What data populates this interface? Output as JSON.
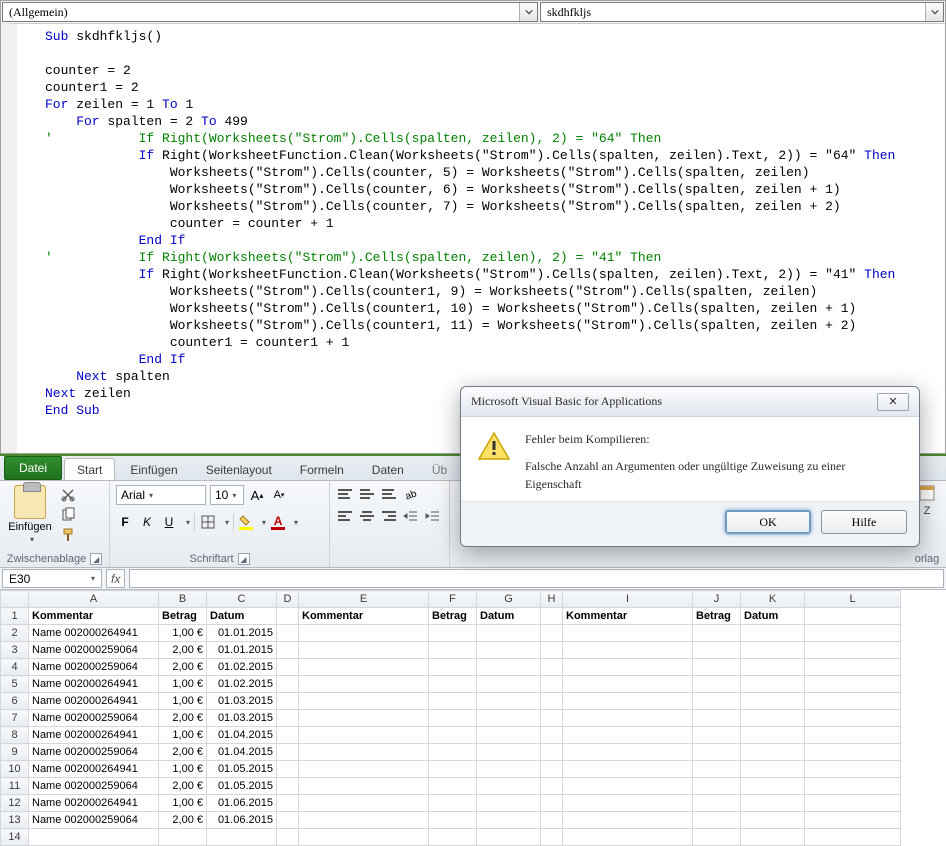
{
  "vba": {
    "object_dd": "(Allgemein)",
    "proc_dd": "skdhfkljs",
    "code": {
      "l1a": "Sub ",
      "l1b": "skdhfkljs()",
      "l2": "",
      "l3": "counter = 2",
      "l4": "counter1 = 2",
      "l5a": "For ",
      "l5b": "zeilen = 1 ",
      "l5c": "To ",
      "l5d": "1",
      "l6a": "    For ",
      "l6b": "spalten = 2 ",
      "l6c": "To ",
      "l6d": "499",
      "l7": "'           If Right(Worksheets(\"Strom\").Cells(spalten, zeilen), 2) = \"64\" Then",
      "l8a": "            If ",
      "l8b": "Right(WorksheetFunction.Clean(Worksheets(\"Strom\").Cells(spalten, zeilen).Text, 2)) = \"64\" ",
      "l8c": "Then",
      "l9": "                Worksheets(\"Strom\").Cells(counter, 5) = Worksheets(\"Strom\").Cells(spalten, zeilen)",
      "l10": "                Worksheets(\"Strom\").Cells(counter, 6) = Worksheets(\"Strom\").Cells(spalten, zeilen + 1)",
      "l11": "                Worksheets(\"Strom\").Cells(counter, 7) = Worksheets(\"Strom\").Cells(spalten, zeilen + 2)",
      "l12": "                counter = counter + 1",
      "l13a": "            End If",
      "l14": "'           If Right(Worksheets(\"Strom\").Cells(spalten, zeilen), 2) = \"41\" Then",
      "l15a": "            If ",
      "l15b": "Right(WorksheetFunction.Clean(Worksheets(\"Strom\").Cells(spalten, zeilen).Text, 2)) = \"41\" ",
      "l15c": "Then",
      "l16": "                Worksheets(\"Strom\").Cells(counter1, 9) = Worksheets(\"Strom\").Cells(spalten, zeilen)",
      "l17": "                Worksheets(\"Strom\").Cells(counter1, 10) = Worksheets(\"Strom\").Cells(spalten, zeilen + 1)",
      "l18": "                Worksheets(\"Strom\").Cells(counter1, 11) = Worksheets(\"Strom\").Cells(spalten, zeilen + 2)",
      "l19": "                counter1 = counter1 + 1",
      "l20a": "            End If",
      "l21a": "    Next ",
      "l21b": "spalten",
      "l22a": "Next ",
      "l22b": "zeilen",
      "l23": "End Sub"
    }
  },
  "dialog": {
    "title": "Microsoft Visual Basic for Applications",
    "close": "✕",
    "heading": "Fehler beim Kompilieren:",
    "message": "Falsche Anzahl an Argumenten oder ungültige Zuweisung zu einer Eigenschaft",
    "ok": "OK",
    "help": "Hilfe"
  },
  "excel": {
    "tabs": {
      "file": "Datei",
      "start": "Start",
      "insert": "Einfügen",
      "layout": "Seitenlayout",
      "formulas": "Formeln",
      "data": "Daten",
      "review_cut": "Üb"
    },
    "ribbon": {
      "clipboard": {
        "paste": "Einfügen",
        "title": "Zwischenablage"
      },
      "font": {
        "name": "Arial",
        "size": "10",
        "title": "Schriftart",
        "bold": "F",
        "italic": "K",
        "underline": "U"
      },
      "orlag_cut": "orlag"
    },
    "namebox": "E30",
    "fx": "fx",
    "cols": [
      "A",
      "B",
      "C",
      "D",
      "E",
      "F",
      "G",
      "H",
      "I",
      "J",
      "K",
      "L"
    ],
    "headers": {
      "kom": "Kommentar",
      "betrag": "Betrag",
      "datum": "Datum"
    },
    "rows": [
      {
        "n": "1"
      },
      {
        "n": "2",
        "a": "Name 002000264941",
        "b": "1,00 €",
        "c": "01.01.2015"
      },
      {
        "n": "3",
        "a": "Name 002000259064",
        "b": "2,00 €",
        "c": "01.01.2015"
      },
      {
        "n": "4",
        "a": "Name 002000259064",
        "b": "2,00 €",
        "c": "01.02.2015"
      },
      {
        "n": "5",
        "a": "Name 002000264941",
        "b": "1,00 €",
        "c": "01.02.2015"
      },
      {
        "n": "6",
        "a": "Name 002000264941",
        "b": "1,00 €",
        "c": "01.03.2015"
      },
      {
        "n": "7",
        "a": "Name 002000259064",
        "b": "2,00 €",
        "c": "01.03.2015"
      },
      {
        "n": "8",
        "a": "Name 002000264941",
        "b": "1,00 €",
        "c": "01.04.2015"
      },
      {
        "n": "9",
        "a": "Name 002000259064",
        "b": "2,00 €",
        "c": "01.04.2015"
      },
      {
        "n": "10",
        "a": "Name 002000264941",
        "b": "1,00 €",
        "c": "01.05.2015"
      },
      {
        "n": "11",
        "a": "Name 002000259064",
        "b": "2,00 €",
        "c": "01.05.2015"
      },
      {
        "n": "12",
        "a": "Name 002000264941",
        "b": "1,00 €",
        "c": "01.06.2015"
      },
      {
        "n": "13",
        "a": "Name 002000259064",
        "b": "2,00 €",
        "c": "01.06.2015"
      },
      {
        "n": "14"
      }
    ]
  }
}
